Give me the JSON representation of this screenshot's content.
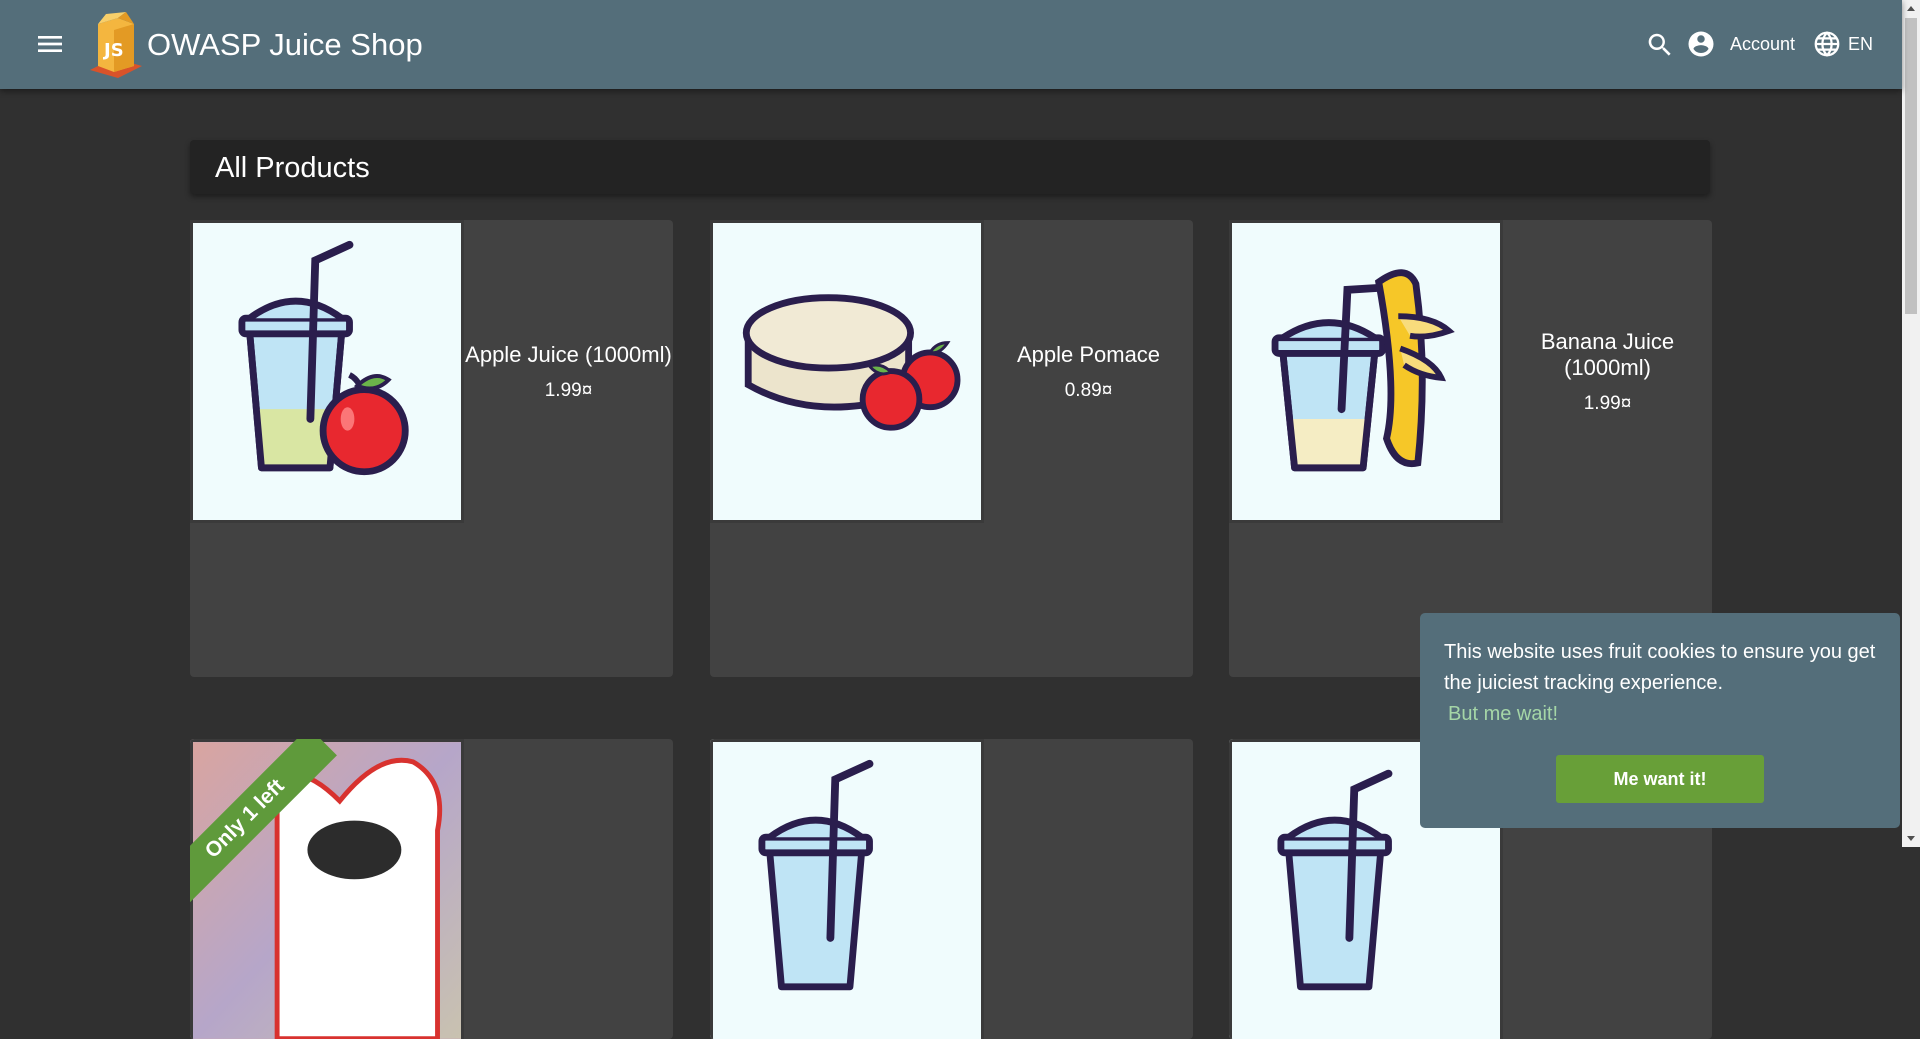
{
  "toolbar": {
    "title": "OWASP Juice Shop",
    "account_label": "Account",
    "language_label": "EN"
  },
  "heading": "All Products",
  "products": [
    {
      "name": "Apple Juice (1000ml)",
      "price": "1.99¤"
    },
    {
      "name": "Apple Pomace",
      "price": "0.89¤"
    },
    {
      "name": "Banana Juice (1000ml)",
      "price": "1.99¤"
    }
  ],
  "row2": {
    "ribbon": "Only 1 left"
  },
  "cookie": {
    "message": "This website uses fruit cookies to ensure you get the juiciest tracking experience.",
    "link": "But me wait!",
    "button": "Me want it!"
  },
  "colors": {
    "toolbar": "#546e7a",
    "background": "#303030",
    "card": "#424242",
    "accent_green": "#689f38"
  }
}
